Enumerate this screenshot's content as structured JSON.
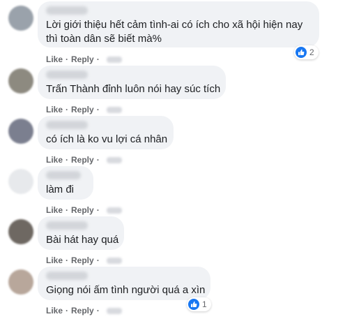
{
  "comments": [
    {
      "lines": [
        "Lời giới thiệu hết cảm tình-ai có ích cho xã hội hiện nay",
        "thì toàn dân sẽ biết mà%"
      ],
      "like_label": "Like",
      "reply_label": "Reply",
      "separator": "·",
      "reaction_count": "2",
      "avatar_color": "#9aa2ab"
    },
    {
      "lines": [
        "Trấn Thành đỉnh luôn nói hay súc tích"
      ],
      "like_label": "Like",
      "reply_label": "Reply",
      "separator": "·",
      "avatar_color": "#8d8a80"
    },
    {
      "lines": [
        "có ích là ko vu lợi cá nhân"
      ],
      "like_label": "Like",
      "reply_label": "Reply",
      "separator": "·",
      "avatar_color": "#7b7f8f"
    },
    {
      "lines": [
        "làm đi"
      ],
      "like_label": "Like",
      "reply_label": "Reply",
      "separator": "·",
      "avatar_color": "#e7e9ec"
    },
    {
      "lines": [
        "Bài hát hay quá"
      ],
      "like_label": "Like",
      "reply_label": "Reply",
      "separator": "·",
      "avatar_color": "#6e6862"
    },
    {
      "lines": [
        "Giọng nói ấm tình người quá a xìn"
      ],
      "like_label": "Like",
      "reply_label": "Reply",
      "separator": "·",
      "reaction_count": "1",
      "avatar_color": "#b8a79b"
    }
  ],
  "colors": {
    "bubble_background": "#f0f2f5",
    "action_text": "#65676b",
    "like_blue": "#1877f2"
  }
}
